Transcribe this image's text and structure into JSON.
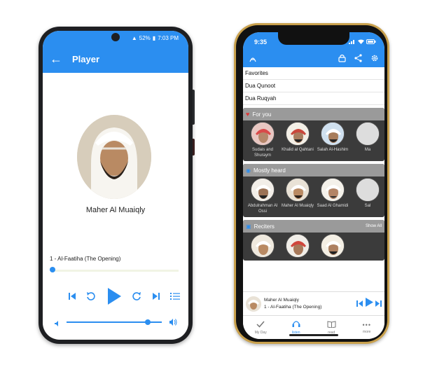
{
  "colors": {
    "accent": "#2b8ef0",
    "frame_gold": "#c9a14d",
    "section_bg": "#3b3b3b"
  },
  "android": {
    "status": {
      "battery": "52%",
      "time": "7:03 PM"
    },
    "appbar": {
      "title": "Player",
      "back_icon": "arrow-left-icon"
    },
    "reciter_name": "Maher Al Muaiqly",
    "track_title": "1 - Al-Faatiha (The Opening)",
    "progress": 0.0,
    "volume": 0.85
  },
  "iphone": {
    "status": {
      "time": "9:35"
    },
    "list": [
      "Favorites",
      "Dua Qunoot",
      "Dua Ruqyah"
    ],
    "sections": {
      "for_you": {
        "title": "For you",
        "reciters": [
          {
            "name": "Sudais and Shuraym"
          },
          {
            "name": "Khalid al Qahtani"
          },
          {
            "name": "Salah Al-Hashim"
          },
          {
            "name": "Ma"
          }
        ]
      },
      "mostly_heard": {
        "title": "Mostly heard",
        "reciters": [
          {
            "name": "Abdulrahman Al Ossi"
          },
          {
            "name": "Maher Al Muaiqly"
          },
          {
            "name": "Saad Al Ghamidi"
          },
          {
            "name": "Sal"
          }
        ]
      },
      "reciters": {
        "title": "Reciters",
        "show_all": "Show All"
      }
    },
    "mini_player": {
      "reciter": "Maher Al Muaiqly",
      "track": "1 - Al-Faatiha (The Opening)"
    },
    "tabs": [
      {
        "label": "My Day",
        "icon": "check-icon"
      },
      {
        "label": "listen",
        "icon": "headphones-icon"
      },
      {
        "label": "read",
        "icon": "book-icon"
      },
      {
        "label": "more",
        "icon": "more-dots-icon"
      }
    ]
  }
}
